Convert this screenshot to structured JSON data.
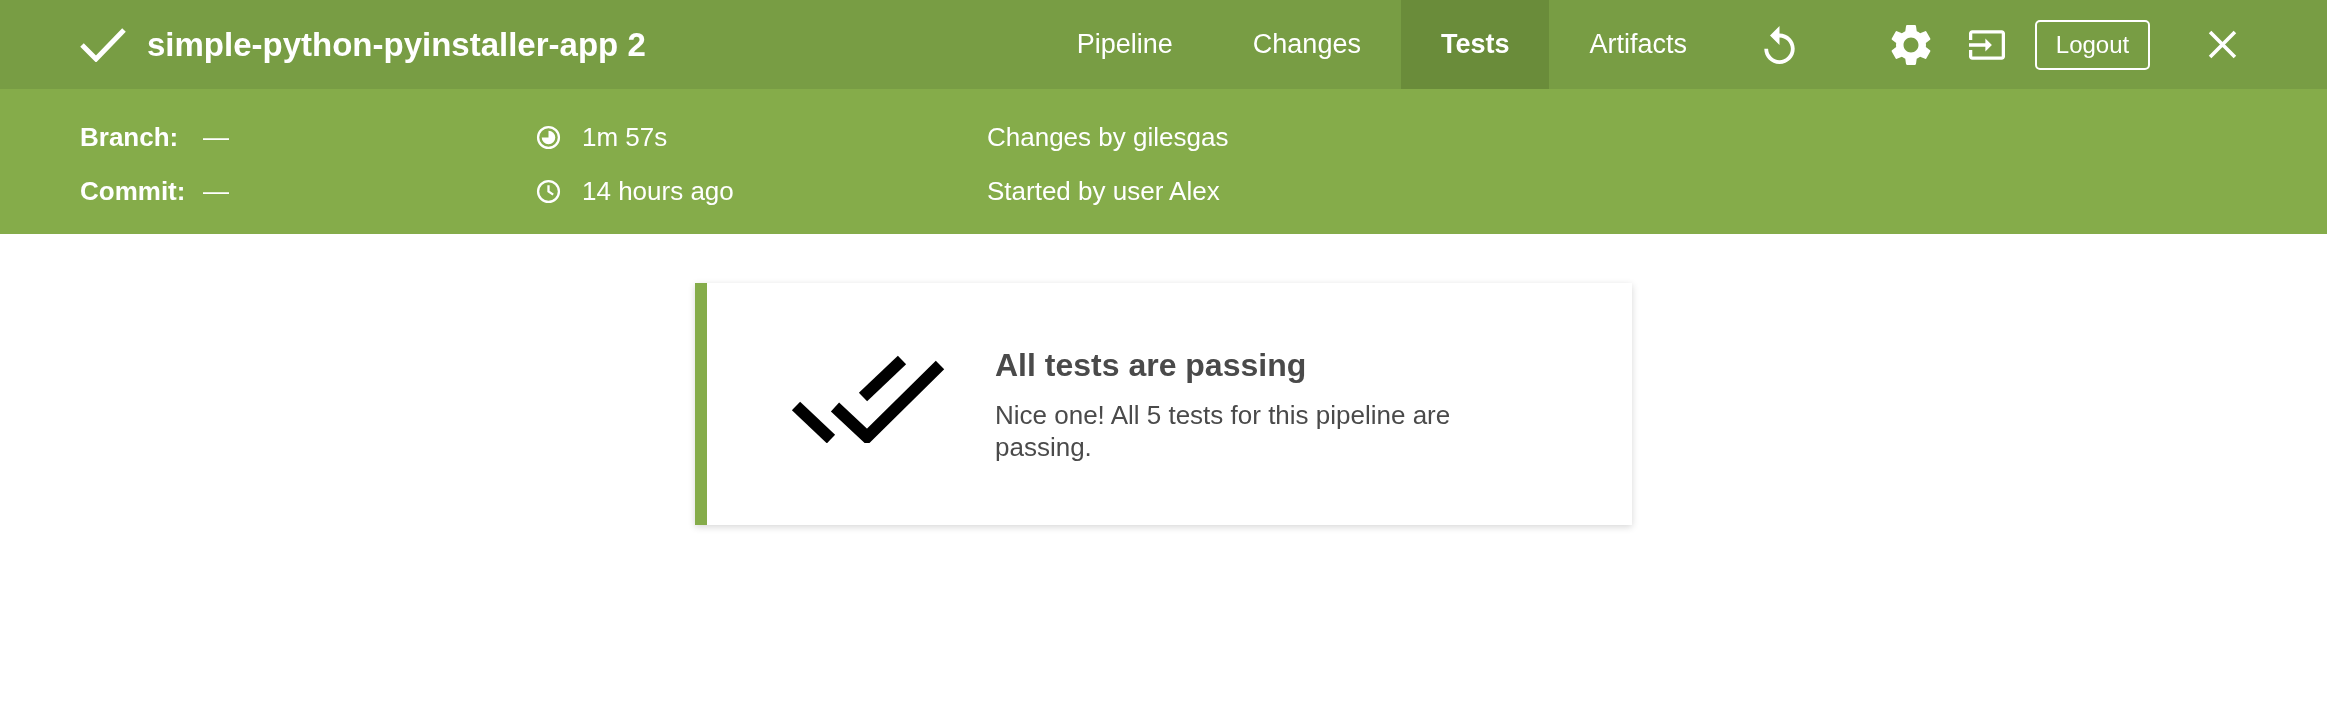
{
  "header": {
    "passed": true,
    "title": "simple-python-pyinstaller-app 2",
    "tabs": [
      {
        "label": "Pipeline",
        "selected": false
      },
      {
        "label": "Changes",
        "selected": false
      },
      {
        "label": "Tests",
        "selected": true
      },
      {
        "label": "Artifacts",
        "selected": false
      }
    ],
    "logout": "Logout"
  },
  "details": {
    "branch": {
      "label": "Branch:",
      "value": "—"
    },
    "commit": {
      "label": "Commit:",
      "value": "—"
    },
    "duration": "1m 57s",
    "time_ago": "14 hours ago",
    "changes": "Changes by gilesgas",
    "started": "Started by user Alex"
  },
  "results": {
    "title": "All tests are passing",
    "message": "Nice one! All 5 tests for this pipeline are passing."
  }
}
